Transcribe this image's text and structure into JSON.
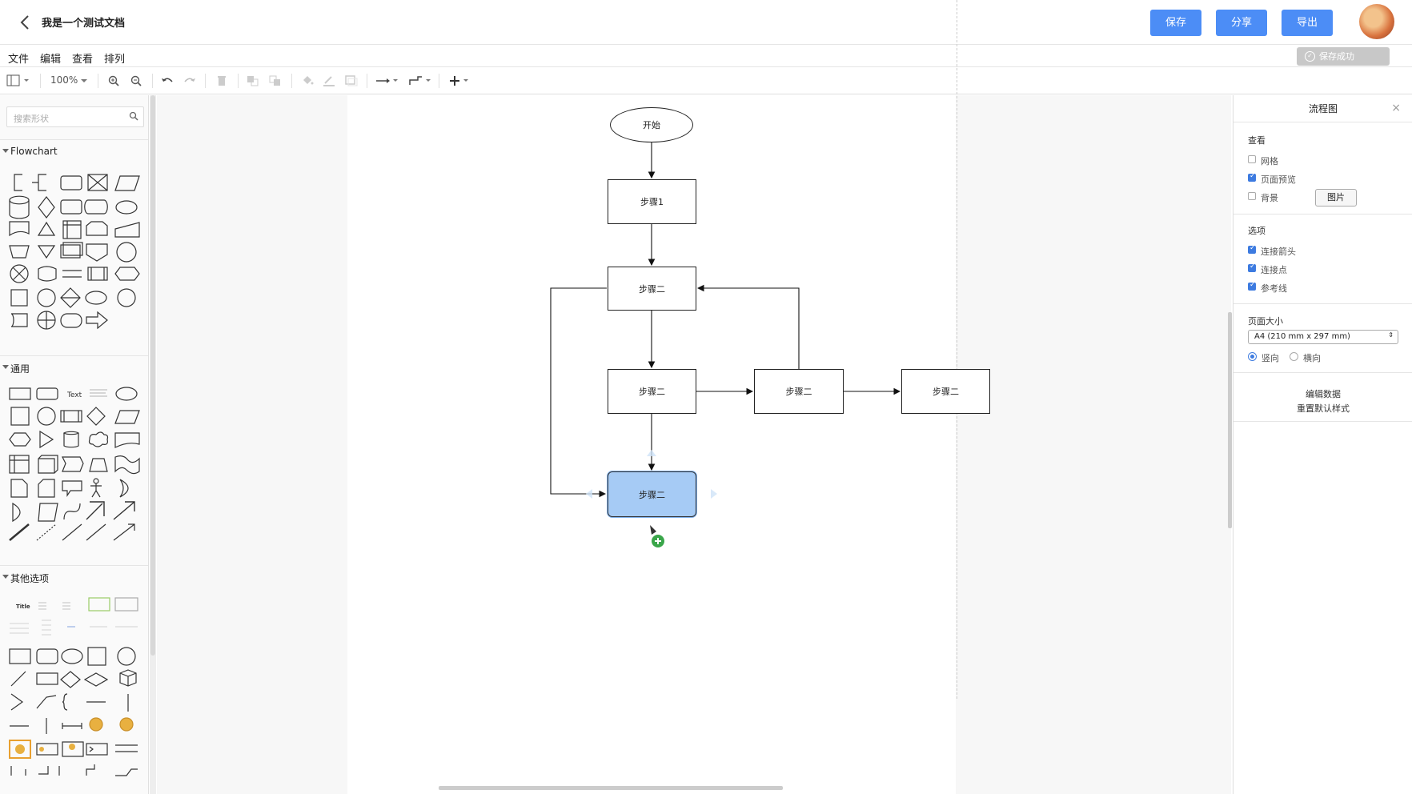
{
  "header": {
    "title": "我是一个测试文档",
    "save_label": "保存",
    "share_label": "分享",
    "export_label": "导出",
    "accent_color": "#4c8df6"
  },
  "menu": [
    "文件",
    "编辑",
    "查看",
    "排列"
  ],
  "save_status": "保存成功",
  "toolbar": {
    "zoom": "100%"
  },
  "left_panel": {
    "search_placeholder": "搜索形状",
    "sections": [
      "Flowchart",
      "通用",
      "其他选项"
    ],
    "text_shape_label": "Text",
    "title_shape_label": "Title"
  },
  "diagram": {
    "start": "开始",
    "step1": "步骤1",
    "step2": "步骤二",
    "selected_fill": "#a6cbf5"
  },
  "right_panel": {
    "title": "流程图",
    "view_label": "查看",
    "grid": "网格",
    "page_view": "页面预览",
    "background": "背景",
    "image_button": "图片",
    "options_label": "选项",
    "connection_arrows": "连接箭头",
    "connection_points": "连接点",
    "guides": "参考线",
    "page_size_label": "页面大小",
    "page_size_value": "A4 (210 mm x 297 mm)",
    "portrait": "竖向",
    "landscape": "横向",
    "edit_data": "编辑数据",
    "reset_style": "重置默认样式",
    "checked": {
      "grid": false,
      "page_view": true,
      "background": false,
      "connection_arrows": true,
      "connection_points": true,
      "guides": true
    },
    "orientation": "portrait"
  }
}
